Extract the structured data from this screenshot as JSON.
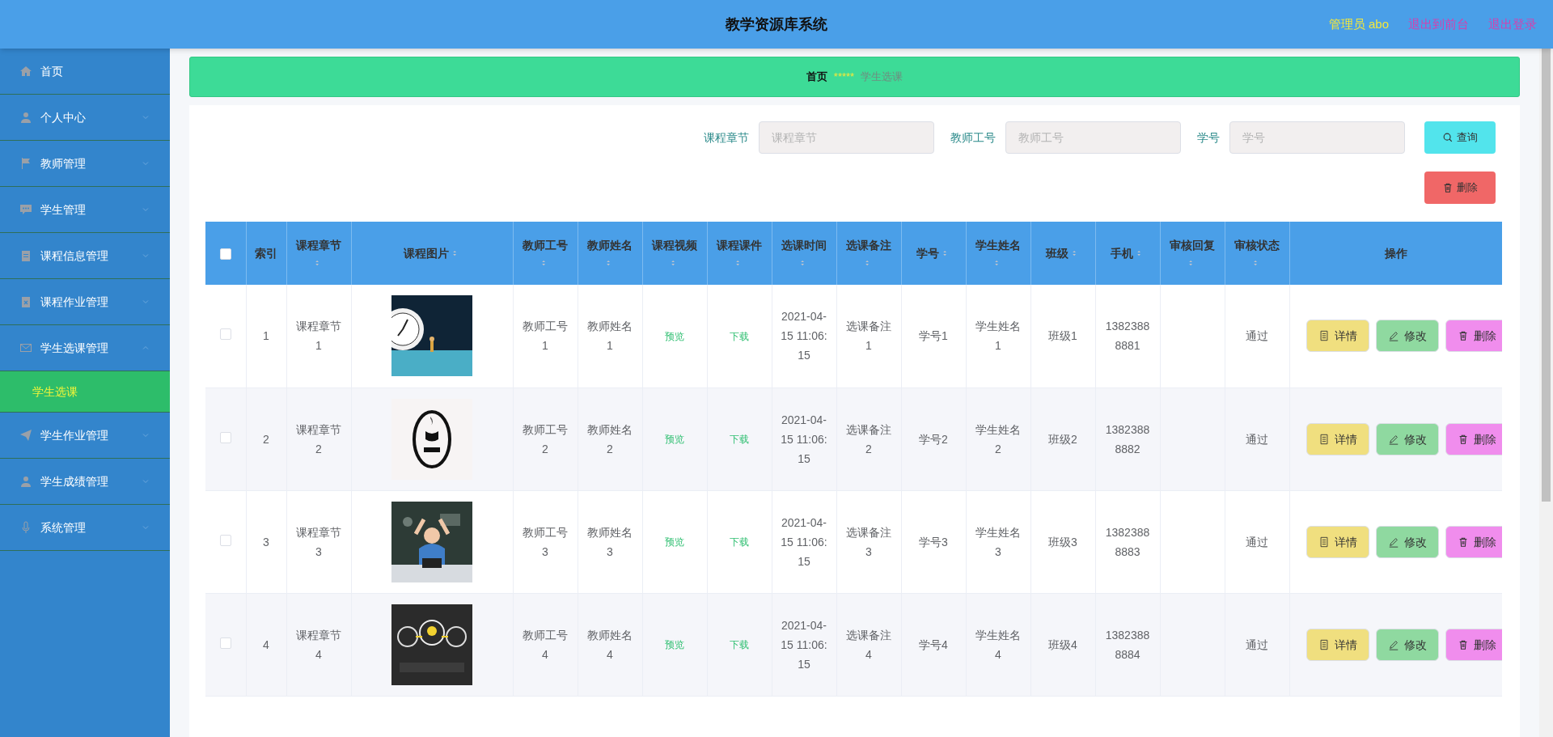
{
  "header": {
    "title": "教学资源库系统",
    "user": "管理员 abo",
    "links": [
      "退出到前台",
      "退出登录"
    ]
  },
  "sidebar": {
    "items": [
      {
        "label": "首页",
        "kind": "link"
      },
      {
        "label": "个人中心",
        "kind": "menu",
        "expanded": false
      },
      {
        "label": "教师管理",
        "kind": "menu",
        "expanded": false
      },
      {
        "label": "学生管理",
        "kind": "menu",
        "expanded": false
      },
      {
        "label": "课程信息管理",
        "kind": "menu",
        "expanded": false
      },
      {
        "label": "课程作业管理",
        "kind": "menu",
        "expanded": false
      },
      {
        "label": "学生选课管理",
        "kind": "menu",
        "expanded": true,
        "children": [
          {
            "label": "学生选课",
            "selected": true
          }
        ]
      },
      {
        "label": "学生作业管理",
        "kind": "menu",
        "expanded": false
      },
      {
        "label": "学生成绩管理",
        "kind": "menu",
        "expanded": false
      },
      {
        "label": "系统管理",
        "kind": "menu",
        "expanded": false
      }
    ]
  },
  "breadcrumb": {
    "home": "首页",
    "separator": "*****",
    "current": "学生选课"
  },
  "search": {
    "fields": [
      {
        "label": "课程章节",
        "placeholder": "课程章节"
      },
      {
        "label": "教师工号",
        "placeholder": "教师工号"
      },
      {
        "label": "学号",
        "placeholder": "学号"
      }
    ],
    "query_button": "查询",
    "delete_button": "删除"
  },
  "table": {
    "select_all_checked": false,
    "columns": [
      {
        "kind": "check"
      },
      {
        "label": "索引",
        "sortable": false
      },
      {
        "label": "课程章节",
        "sortable": true
      },
      {
        "label": "课程图片",
        "sortable": true
      },
      {
        "label": "教师工号",
        "sortable": true
      },
      {
        "label": "教师姓名",
        "sortable": true
      },
      {
        "label": "课程视频",
        "sortable": true
      },
      {
        "label": "课程课件",
        "sortable": true
      },
      {
        "label": "选课时间",
        "sortable": true
      },
      {
        "label": "选课备注",
        "sortable": true
      },
      {
        "label": "学号",
        "sortable": true
      },
      {
        "label": "学生姓名",
        "sortable": true
      },
      {
        "label": "班级",
        "sortable": true
      },
      {
        "label": "手机",
        "sortable": true
      },
      {
        "label": "审核回复",
        "sortable": true
      },
      {
        "label": "审核状态",
        "sortable": true
      },
      {
        "label": "操作",
        "sortable": false
      }
    ],
    "rows": [
      {
        "checked": false,
        "index": "1",
        "chapter": "课程章节1",
        "picture": {
          "kind": "picture"
        },
        "teacher_no": "教师工号1",
        "teacher_name": "教师姓名1",
        "video": "预览",
        "courseware": "下载",
        "time": "2021-04-15 11:06:15",
        "note": "选课备注1",
        "student_no": "学号1",
        "student_name": "学生姓名1",
        "class": "班级1",
        "phone": "13823888881",
        "reply": "",
        "status": "通过",
        "actions": [
          "详情",
          "修改",
          "删除"
        ]
      },
      {
        "checked": false,
        "index": "2",
        "chapter": "课程章节2",
        "picture": {
          "kind": "picture"
        },
        "teacher_no": "教师工号2",
        "teacher_name": "教师姓名2",
        "video": "预览",
        "courseware": "下载",
        "time": "2021-04-15 11:06:15",
        "note": "选课备注2",
        "student_no": "学号2",
        "student_name": "学生姓名2",
        "class": "班级2",
        "phone": "13823888882",
        "reply": "",
        "status": "通过",
        "actions": [
          "详情",
          "修改",
          "删除"
        ]
      },
      {
        "checked": false,
        "index": "3",
        "chapter": "课程章节3",
        "picture": {
          "kind": "picture"
        },
        "teacher_no": "教师工号3",
        "teacher_name": "教师姓名3",
        "video": "预览",
        "courseware": "下载",
        "time": "2021-04-15 11:06:15",
        "note": "选课备注3",
        "student_no": "学号3",
        "student_name": "学生姓名3",
        "class": "班级3",
        "phone": "13823888883",
        "reply": "",
        "status": "通过",
        "actions": [
          "详情",
          "修改",
          "删除"
        ]
      },
      {
        "checked": false,
        "index": "4",
        "chapter": "课程章节4",
        "picture": {
          "kind": "picture"
        },
        "teacher_no": "教师工号4",
        "teacher_name": "教师姓名4",
        "video": "预览",
        "courseware": "下载",
        "time": "2021-04-15 11:06:15",
        "note": "选课备注4",
        "student_no": "学号4",
        "student_name": "学生姓名4",
        "class": "班级4",
        "phone": "13823888884",
        "reply": "",
        "status": "通过",
        "actions": [
          "详情",
          "修改",
          "删除"
        ]
      }
    ]
  }
}
